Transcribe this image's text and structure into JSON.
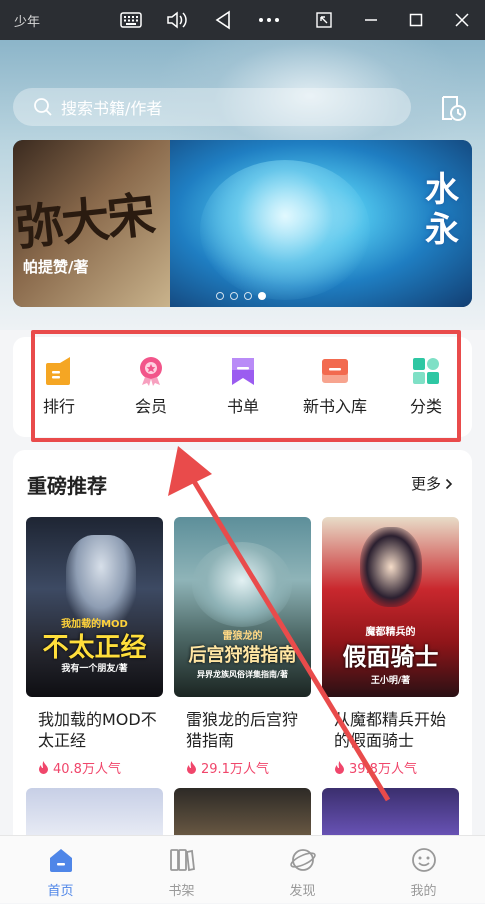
{
  "window": {
    "app_name": "少年",
    "controls": [
      "keyboard-icon",
      "volume-icon",
      "back-icon",
      "more-icon",
      "popout-icon",
      "minimize-icon",
      "maximize-icon",
      "close-icon"
    ]
  },
  "search": {
    "placeholder": "搜索书籍/作者"
  },
  "banner": {
    "left_title": "弥大宋",
    "left_author": "帕提赞/著",
    "right_text": "水永",
    "slide_count": 4,
    "active_slide": 4
  },
  "quick_menu": {
    "items": [
      {
        "label": "排行",
        "icon": "ranking-icon",
        "color": "#f5a623"
      },
      {
        "label": "会员",
        "icon": "vip-icon",
        "color": "#f2558a"
      },
      {
        "label": "书单",
        "icon": "booklist-icon",
        "color": "#9b5cf0"
      },
      {
        "label": "新书入库",
        "icon": "new-books-icon",
        "color": "#f26a4f"
      },
      {
        "label": "分类",
        "icon": "category-icon",
        "color": "#2ec7a3"
      }
    ]
  },
  "recommend": {
    "title": "重磅推荐",
    "more_label": "更多",
    "books": [
      {
        "name": "我加载的MOD不太正经",
        "popularity": "40.8万人气",
        "cover_title": "不太正经",
        "cover_sub": "我加载的MOD",
        "cover_author": "我有一个朋友/著"
      },
      {
        "name": "雷狼龙的后宫狩猎指南",
        "popularity": "29.1万人气",
        "cover_title": "后宫狩猎指南",
        "cover_sub": "雷狼龙的",
        "cover_author": "异界龙族风俗详集指南/著"
      },
      {
        "name": "从魔都精兵开始的假面骑士",
        "popularity": "39.8万人气",
        "cover_title": "假面骑士",
        "cover_sub": "魔都精兵的",
        "cover_author": "王小明/著"
      }
    ]
  },
  "bottom_nav": {
    "items": [
      {
        "label": "首页",
        "icon": "home-icon",
        "active": true
      },
      {
        "label": "书架",
        "icon": "bookshelf-icon",
        "active": false
      },
      {
        "label": "发现",
        "icon": "discover-icon",
        "active": false
      },
      {
        "label": "我的",
        "icon": "profile-icon",
        "active": false
      }
    ]
  },
  "colors": {
    "accent": "#4f86e8",
    "highlight_border": "#e94b4b",
    "popularity": "#f0466b"
  }
}
